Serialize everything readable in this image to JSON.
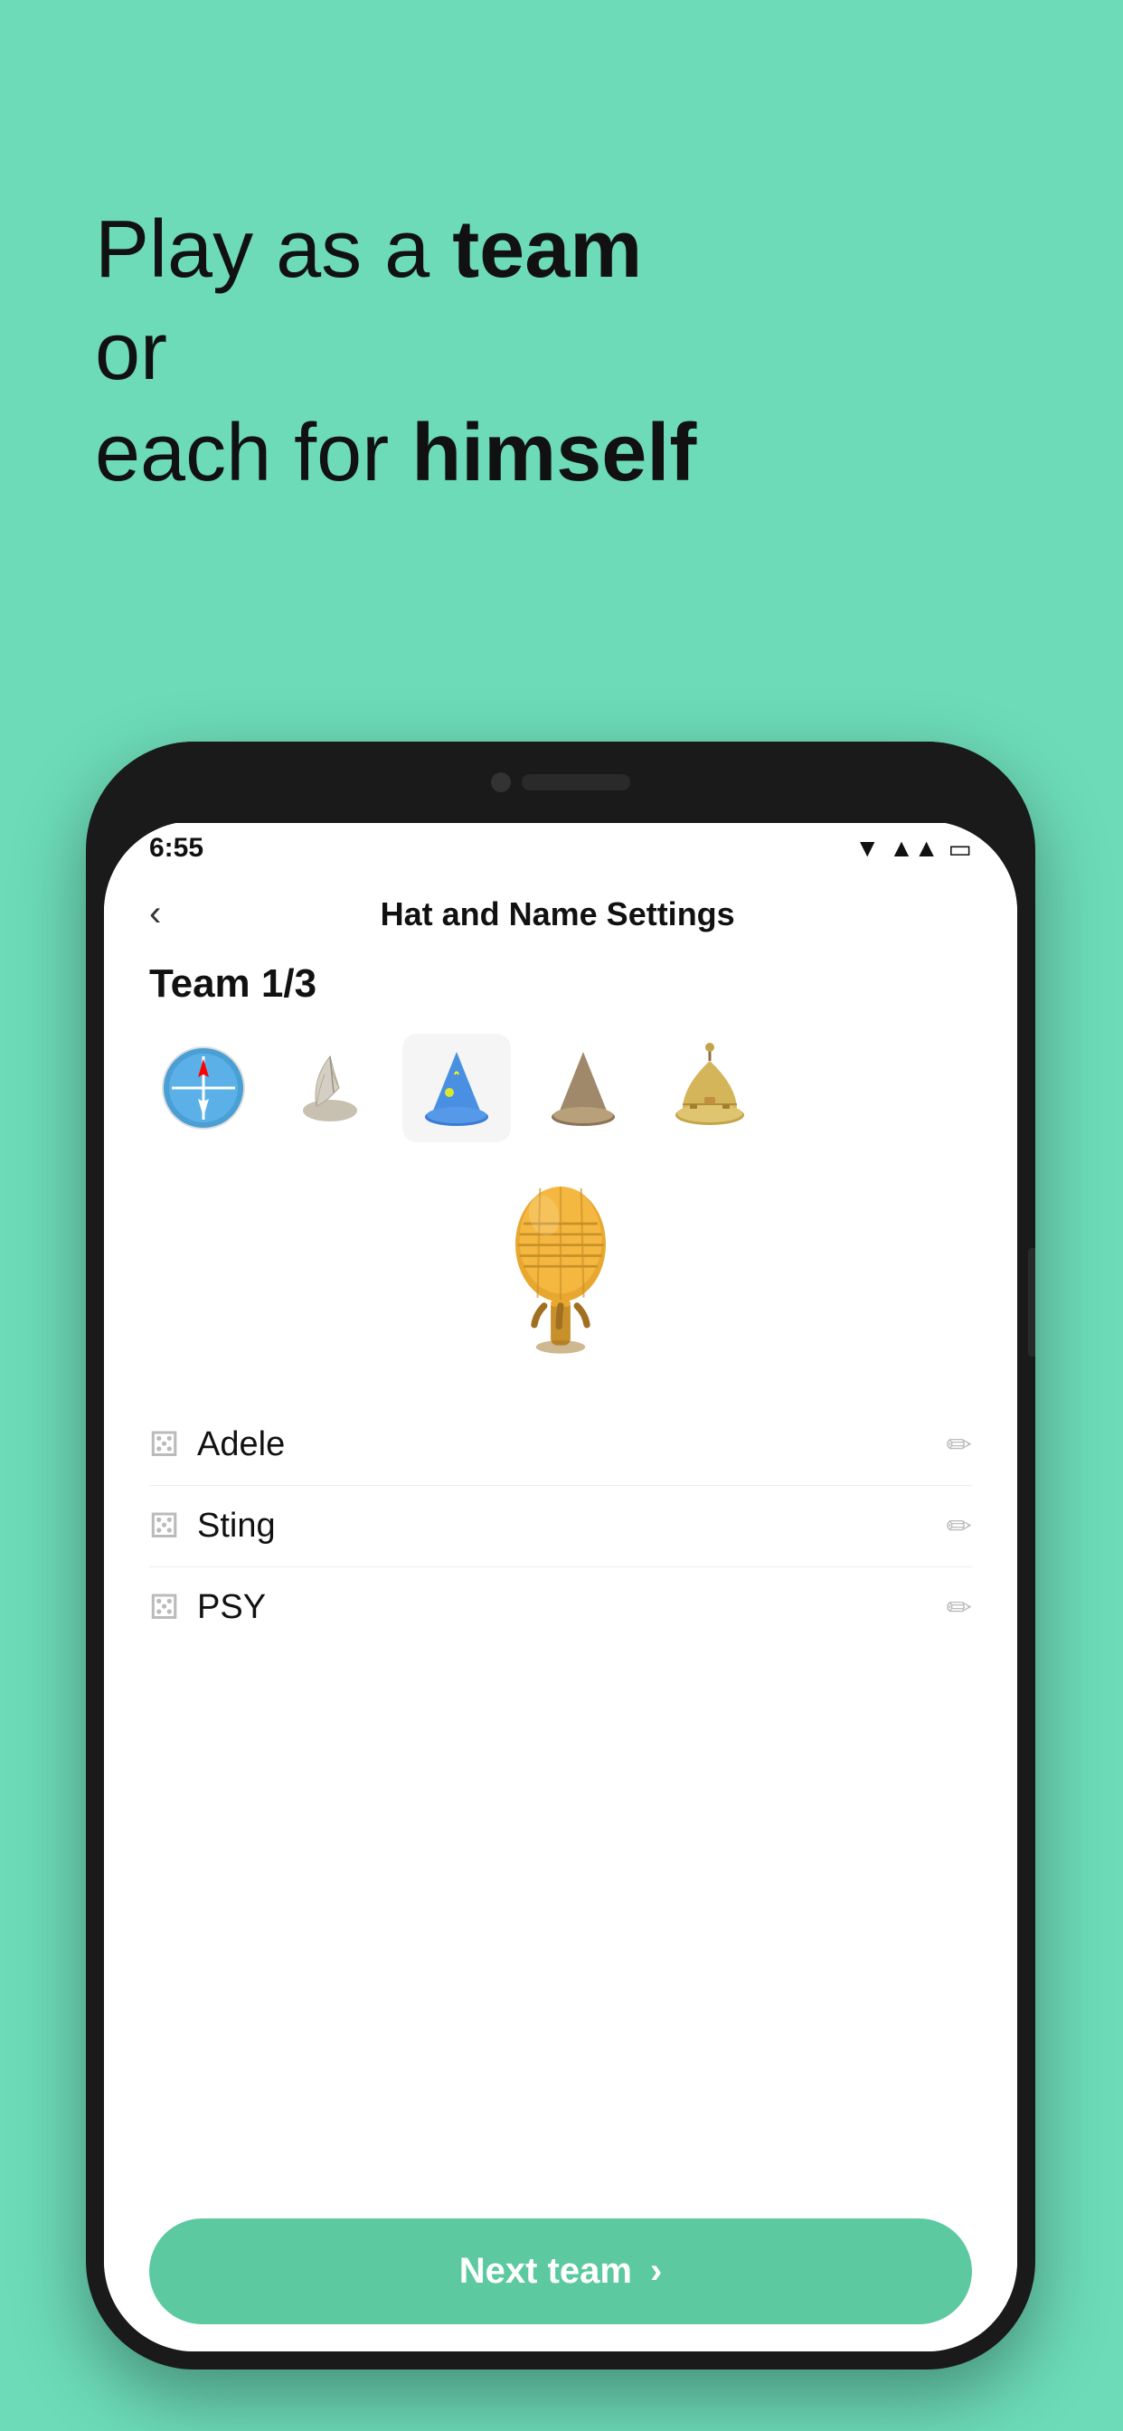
{
  "background_color": "#6DDBB8",
  "hero": {
    "line1": "Play as a ",
    "line1_bold": "team",
    "line2": "or",
    "line3": "each for ",
    "line3_bold": "himself"
  },
  "phone": {
    "status_bar": {
      "time": "6:55"
    },
    "nav": {
      "back_label": "‹",
      "title": "Hat and Name Settings"
    },
    "team_label": "Team 1/3",
    "hats": [
      {
        "emoji": "🧭",
        "id": "compass"
      },
      {
        "emoji": "🎤",
        "id": "mic-hat"
      },
      {
        "emoji": "🧙",
        "id": "wizard-blue"
      },
      {
        "emoji": "🎩",
        "id": "wizard-brown"
      },
      {
        "emoji": "🔔",
        "id": "bell-hat"
      }
    ],
    "selected_hat_emoji": "🎤",
    "players": [
      {
        "name": "Adele",
        "dice": "⚄"
      },
      {
        "name": "Sting",
        "dice": "⚄"
      },
      {
        "name": "PSY",
        "dice": "⚄"
      }
    ],
    "next_team_button": {
      "label": "Next team",
      "chevron": "›"
    }
  }
}
